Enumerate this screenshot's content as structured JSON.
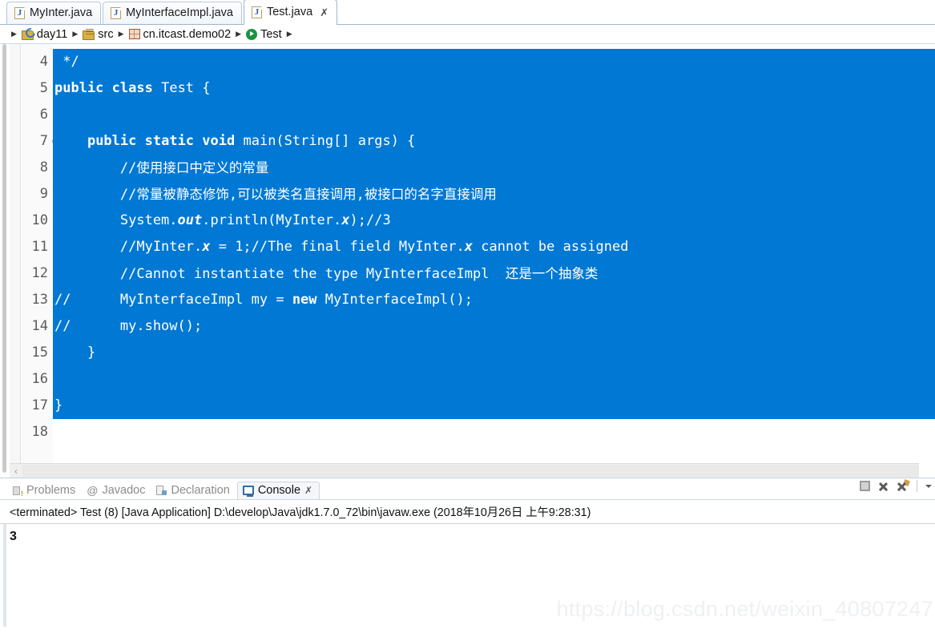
{
  "editor_tabs": [
    {
      "label": "MyInter.java",
      "icon": "java-file-icon",
      "active": false,
      "closable": false
    },
    {
      "label": "MyInterfaceImpl.java",
      "icon": "java-file-icon",
      "active": false,
      "closable": false
    },
    {
      "label": "Test.java",
      "icon": "java-file-icon",
      "active": true,
      "closable": true,
      "close_glyph": "✗"
    }
  ],
  "breadcrumb": {
    "separator": "▶",
    "items": [
      {
        "label": "day11",
        "icon": "java-project-icon"
      },
      {
        "label": "src",
        "icon": "source-folder-icon"
      },
      {
        "label": "cn.itcast.demo02",
        "icon": "package-icon"
      },
      {
        "label": "Test",
        "icon": "runnable-class-icon"
      }
    ]
  },
  "editor": {
    "selection_color": "#0078d4",
    "selection_text_color": "#ffffff",
    "lines": [
      {
        "num": "4",
        "selected": true,
        "fold": false,
        "text": " */"
      },
      {
        "num": "5",
        "selected": true,
        "fold": false,
        "text": "public class Test {"
      },
      {
        "num": "6",
        "selected": true,
        "fold": false,
        "text": ""
      },
      {
        "num": "7",
        "selected": true,
        "fold": true,
        "text": "    public static void main(String[] args) {"
      },
      {
        "num": "8",
        "selected": true,
        "fold": false,
        "text": "        //使用接口中定义的常量"
      },
      {
        "num": "9",
        "selected": true,
        "fold": false,
        "text": "        //常量被静态修饰,可以被类名直接调用,被接口的名字直接调用"
      },
      {
        "num": "10",
        "selected": true,
        "fold": false,
        "text": "        System.out.println(MyInter.x);//3"
      },
      {
        "num": "11",
        "selected": true,
        "fold": false,
        "text": "        //MyInter.x = 1;//The final field MyInter.x cannot be assigned"
      },
      {
        "num": "12",
        "selected": true,
        "fold": false,
        "text": "        //Cannot instantiate the type MyInterfaceImpl  还是一个抽象类"
      },
      {
        "num": "13",
        "selected": true,
        "fold": false,
        "text": "//      MyInterfaceImpl my = new MyInterfaceImpl();"
      },
      {
        "num": "14",
        "selected": true,
        "fold": false,
        "text": "//      my.show();"
      },
      {
        "num": "15",
        "selected": true,
        "fold": false,
        "text": "    }"
      },
      {
        "num": "16",
        "selected": true,
        "fold": false,
        "text": ""
      },
      {
        "num": "17",
        "selected": true,
        "fold": false,
        "text": "}"
      },
      {
        "num": "18",
        "selected": false,
        "fold": false,
        "text": ""
      }
    ],
    "hscroll_left_glyph": "‹"
  },
  "console_panel": {
    "tabs": [
      {
        "label": "Problems",
        "icon": "problems-icon",
        "active": false
      },
      {
        "label": "Javadoc",
        "icon": "javadoc-icon",
        "active": false,
        "glyph": "@"
      },
      {
        "label": "Declaration",
        "icon": "declaration-icon",
        "active": false
      },
      {
        "label": "Console",
        "icon": "console-icon",
        "active": true,
        "close_glyph": "✗"
      }
    ],
    "toolbar": [
      {
        "name": "terminate-button",
        "icon": "stop-square-icon"
      },
      {
        "name": "remove-launch-button",
        "icon": "remove-x-icon"
      },
      {
        "name": "remove-all-terminated-button",
        "icon": "remove-all-x-icon"
      },
      {
        "name": "view-menu-button",
        "icon": "chevron-down-icon"
      }
    ],
    "header": "<terminated> Test (8) [Java Application] D:\\develop\\Java\\jdk1.7.0_72\\bin\\javaw.exe (2018年10月26日 上午9:28:31)",
    "output": "3"
  },
  "watermark": "https://blog.csdn.net/weixin_40807247"
}
